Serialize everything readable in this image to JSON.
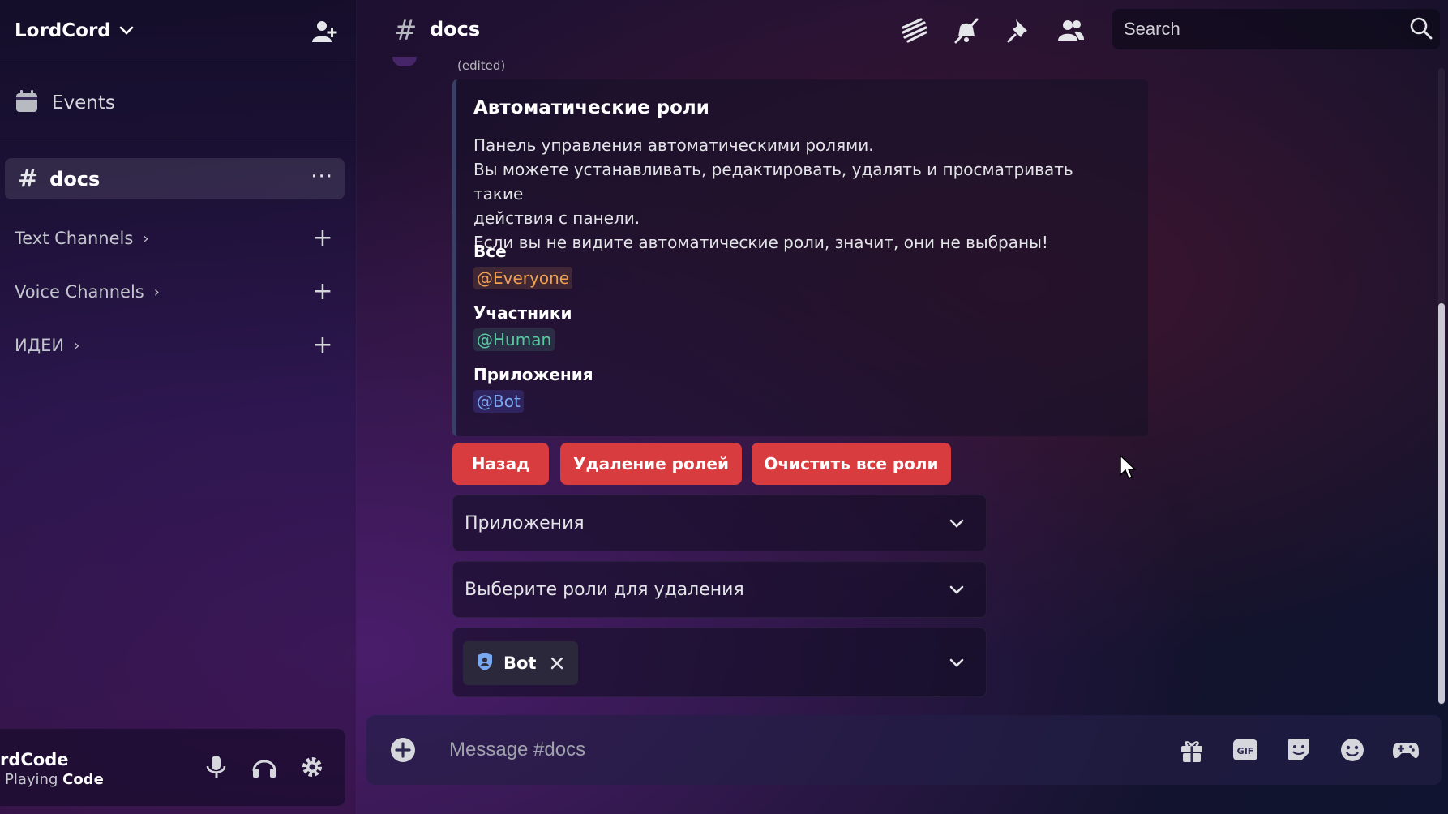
{
  "server": {
    "name": "LordCord"
  },
  "sidebar": {
    "events_label": "Events",
    "active_channel": {
      "name": "docs",
      "hash": "#",
      "more": "···"
    },
    "categories": [
      {
        "label": "Text Channels",
        "arrow": "›",
        "add": "+"
      },
      {
        "label": "Voice Channels",
        "arrow": "›",
        "add": "+"
      },
      {
        "label": "ИДЕИ",
        "arrow": "›",
        "add": "+"
      }
    ]
  },
  "user": {
    "name": "rdCode",
    "status_prefix": "Playing",
    "status_game": "Code"
  },
  "topbar": {
    "hash": "#",
    "channel": "docs",
    "search_placeholder": "Search"
  },
  "message": {
    "edited": "(edited)",
    "embed": {
      "title": "Автоматические роли",
      "description": [
        "Панель управления автоматическими ролями.",
        "Вы можете устанавливать, редактировать, удалять и просматривать такие",
        "действия с панели.",
        "Если вы не видите автоматические роли, значит, они не выбраны!"
      ],
      "fields": [
        {
          "name": "Все",
          "value": "@Everyone",
          "color": "#f0a050",
          "bg": "rgba(240,160,80,0.15)"
        },
        {
          "name": "Участники",
          "value": "@Human",
          "color": "#58c9a0",
          "bg": "rgba(88,201,160,0.15)"
        },
        {
          "name": "Приложения",
          "value": "@Bot",
          "color": "#7aa8f0",
          "bg": "rgba(88,101,242,0.22)"
        }
      ]
    },
    "buttons": [
      "Назад",
      "Удаление ролей",
      "Очистить все роли"
    ],
    "selects": [
      {
        "label": "Приложения"
      },
      {
        "label": "Выберите роли для удаления"
      }
    ],
    "chip": {
      "name": "Bot"
    }
  },
  "composer": {
    "placeholder": "Message #docs",
    "gif_label": "GIF"
  },
  "colors": {
    "button_red": "#d83c3e",
    "accent": "#5865f2"
  }
}
